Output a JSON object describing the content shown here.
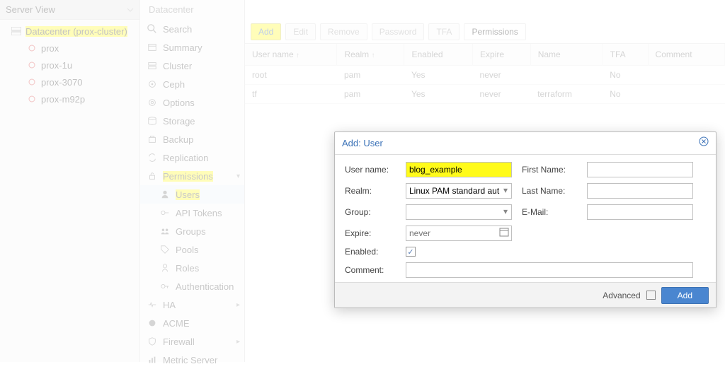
{
  "left": {
    "title": "Server View",
    "nodes": {
      "datacenter": "Datacenter (prox-cluster)",
      "n0": "prox",
      "n1": "prox-1u",
      "n2": "prox-3070",
      "n3": "prox-m92p"
    }
  },
  "crumb": "Datacenter",
  "mid": {
    "search": "Search",
    "summary": "Summary",
    "cluster": "Cluster",
    "ceph": "Ceph",
    "options": "Options",
    "storage": "Storage",
    "backup": "Backup",
    "replication": "Replication",
    "permissions": "Permissions",
    "users": "Users",
    "apitokens": "API Tokens",
    "groups": "Groups",
    "pools": "Pools",
    "roles": "Roles",
    "auth": "Authentication",
    "ha": "HA",
    "acme": "ACME",
    "firewall": "Firewall",
    "metric": "Metric Server"
  },
  "toolbar": {
    "add": "Add",
    "edit": "Edit",
    "remove": "Remove",
    "password": "Password",
    "tfa": "TFA",
    "permissions": "Permissions"
  },
  "columns": {
    "user": "User name",
    "realm": "Realm",
    "enabled": "Enabled",
    "expire": "Expire",
    "name": "Name",
    "tfa": "TFA",
    "comment": "Comment"
  },
  "rows": [
    {
      "user": "root",
      "realm": "pam",
      "enabled": "Yes",
      "expire": "never",
      "name": "",
      "tfa": "No"
    },
    {
      "user": "tf",
      "realm": "pam",
      "enabled": "Yes",
      "expire": "never",
      "name": "terraform",
      "tfa": "No"
    }
  ],
  "modal": {
    "title": "Add: User",
    "labels": {
      "user": "User name:",
      "realm": "Realm:",
      "group": "Group:",
      "expire": "Expire:",
      "enabled": "Enabled:",
      "first": "First Name:",
      "last": "Last Name:",
      "email": "E-Mail:",
      "comment": "Comment:"
    },
    "values": {
      "user": "blog_example",
      "realm": "Linux PAM standard aut",
      "group": "",
      "expire_placeholder": "never",
      "enabled": "✓",
      "first": "",
      "last": "",
      "email": "",
      "comment": ""
    },
    "footer": {
      "advanced": "Advanced",
      "add": "Add"
    }
  }
}
